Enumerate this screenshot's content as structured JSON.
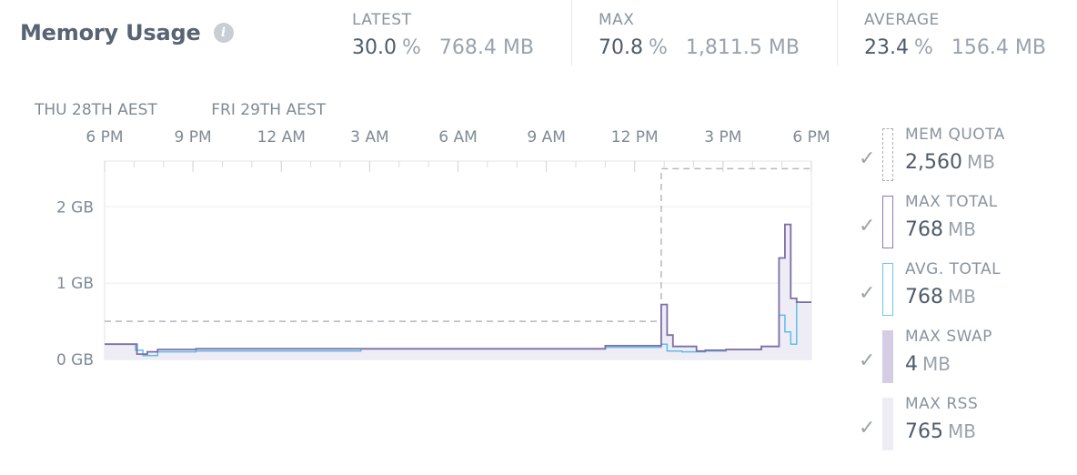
{
  "header": {
    "title": "Memory Usage",
    "info_icon": "i",
    "stats": [
      {
        "label": "LATEST",
        "pct": "30.0",
        "pct_unit": "%",
        "mb": "768.4 MB"
      },
      {
        "label": "MAX",
        "pct": "70.8",
        "pct_unit": "%",
        "mb": "1,811.5 MB"
      },
      {
        "label": "AVERAGE",
        "pct": "23.4",
        "pct_unit": "%",
        "mb": "156.4 MB"
      }
    ]
  },
  "legend": [
    {
      "name": "MEM QUOTA",
      "value": "2,560",
      "unit": "MB",
      "color": "#a8adb5",
      "style": "dashed"
    },
    {
      "name": "MAX TOTAL",
      "value": "768",
      "unit": "MB",
      "color": "#8c7bb0",
      "style": "outline"
    },
    {
      "name": "AVG. TOTAL",
      "value": "768",
      "unit": "MB",
      "color": "#6cc6ea",
      "style": "outline"
    },
    {
      "name": "MAX SWAP",
      "value": "4",
      "unit": "MB",
      "color": "#d4cde3",
      "style": "fill"
    },
    {
      "name": "MAX RSS",
      "value": "765",
      "unit": "MB",
      "color": "#eeecf4",
      "style": "fill"
    }
  ],
  "legend_check": "✓",
  "chart_data": {
    "type": "area",
    "x_unit": "hours since 6 PM Thu 28th AEST",
    "x_range": [
      0,
      24
    ],
    "ylim": [
      0,
      2.6
    ],
    "y_unit": "GB",
    "day_labels": [
      {
        "text": "THU 28TH AEST",
        "x": 0
      },
      {
        "text": "FRI 29TH AEST",
        "x": 6
      }
    ],
    "x_ticks": [
      {
        "label": "6 PM",
        "x": 0
      },
      {
        "label": "9 PM",
        "x": 3
      },
      {
        "label": "12 AM",
        "x": 6
      },
      {
        "label": "3 AM",
        "x": 9
      },
      {
        "label": "6 AM",
        "x": 12
      },
      {
        "label": "9 AM",
        "x": 15
      },
      {
        "label": "12 PM",
        "x": 18
      },
      {
        "label": "3 PM",
        "x": 21
      },
      {
        "label": "6 PM",
        "x": 24
      }
    ],
    "y_ticks": [
      {
        "label": "0 GB",
        "y": 0
      },
      {
        "label": "1 GB",
        "y": 1
      },
      {
        "label": "2 GB",
        "y": 2
      }
    ],
    "grid": true,
    "series": [
      {
        "name": "MEM QUOTA",
        "color": "#b4b8be",
        "step": true,
        "x": [
          0,
          18.9,
          18.9,
          24
        ],
        "y": [
          0.5,
          0.5,
          2.5,
          2.5
        ]
      },
      {
        "name": "MAX TOTAL",
        "color": "#7e6ea6",
        "step": true,
        "x": [
          0,
          1.1,
          1.1,
          1.45,
          1.45,
          1.8,
          1.8,
          3.1,
          3.1,
          17,
          17,
          18.9,
          18.9,
          19.1,
          19.1,
          19.3,
          19.3,
          20.1,
          20.1,
          20.4,
          20.4,
          21.1,
          21.1,
          22.3,
          22.3,
          22.9,
          22.9,
          23.1,
          23.1,
          23.3,
          23.3,
          23.5,
          23.5,
          24
        ],
        "y": [
          0.2,
          0.2,
          0.07,
          0.07,
          0.1,
          0.1,
          0.13,
          0.13,
          0.14,
          0.14,
          0.18,
          0.18,
          0.72,
          0.72,
          0.32,
          0.32,
          0.17,
          0.17,
          0.11,
          0.11,
          0.12,
          0.12,
          0.13,
          0.13,
          0.17,
          0.17,
          1.33,
          1.33,
          1.77,
          1.77,
          0.8,
          0.8,
          0.75,
          0.75
        ]
      },
      {
        "name": "AVG. TOTAL",
        "color": "#5cbfe8",
        "step": true,
        "x": [
          0,
          1.05,
          1.05,
          1.3,
          1.3,
          1.8,
          1.8,
          3.1,
          3.1,
          8.7,
          8.7,
          17,
          17,
          18.9,
          18.9,
          19.1,
          19.1,
          19.6,
          19.6,
          20.1,
          20.1,
          20.4,
          20.4,
          21.1,
          21.1,
          22.3,
          22.3,
          22.9,
          22.9,
          23.1,
          23.1,
          23.3,
          23.3,
          23.5,
          23.5,
          24
        ],
        "y": [
          0.2,
          0.2,
          0.12,
          0.12,
          0.05,
          0.05,
          0.1,
          0.1,
          0.11,
          0.11,
          0.14,
          0.14,
          0.16,
          0.16,
          0.2,
          0.2,
          0.11,
          0.11,
          0.1,
          0.1,
          0.1,
          0.1,
          0.11,
          0.11,
          0.13,
          0.13,
          0.17,
          0.17,
          0.58,
          0.58,
          0.36,
          0.36,
          0.2,
          0.2,
          0.75,
          0.75
        ]
      }
    ]
  }
}
